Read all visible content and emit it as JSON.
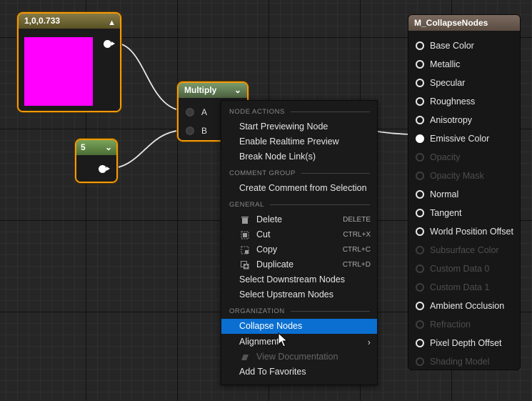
{
  "graph": {
    "color_node": {
      "title": "1,0,0.733",
      "swatch_color": "#ff00ff",
      "collapse_icon": "chevron-up-icon"
    },
    "constant_node": {
      "value": "5"
    },
    "multiply_node": {
      "title": "Multiply",
      "inputs": [
        "A",
        "B"
      ]
    },
    "result_node": {
      "title": "M_CollapseNodes",
      "inputs": [
        {
          "label": "Base Color",
          "enabled": true
        },
        {
          "label": "Metallic",
          "enabled": true
        },
        {
          "label": "Specular",
          "enabled": true
        },
        {
          "label": "Roughness",
          "enabled": true
        },
        {
          "label": "Anisotropy",
          "enabled": true
        },
        {
          "label": "Emissive Color",
          "enabled": true,
          "connected": true
        },
        {
          "label": "Opacity",
          "enabled": false
        },
        {
          "label": "Opacity Mask",
          "enabled": false
        },
        {
          "label": "Normal",
          "enabled": true
        },
        {
          "label": "Tangent",
          "enabled": true
        },
        {
          "label": "World Position Offset",
          "enabled": true
        },
        {
          "label": "Subsurface Color",
          "enabled": false
        },
        {
          "label": "Custom Data 0",
          "enabled": false
        },
        {
          "label": "Custom Data 1",
          "enabled": false
        },
        {
          "label": "Ambient Occlusion",
          "enabled": true
        },
        {
          "label": "Refraction",
          "enabled": false
        },
        {
          "label": "Pixel Depth Offset",
          "enabled": true
        },
        {
          "label": "Shading Model",
          "enabled": false
        }
      ]
    }
  },
  "context_menu": {
    "sections": {
      "node_actions": "NODE ACTIONS",
      "comment_group": "COMMENT GROUP",
      "general": "GENERAL",
      "organization": "ORGANIZATION"
    },
    "items": {
      "start_previewing": "Start Previewing Node",
      "enable_realtime": "Enable Realtime Preview",
      "break_links": "Break Node Link(s)",
      "create_comment": "Create Comment from Selection",
      "delete": {
        "label": "Delete",
        "shortcut": "DELETE",
        "icon": "trash-icon"
      },
      "cut": {
        "label": "Cut",
        "shortcut": "CTRL+X",
        "icon": "scissors-icon"
      },
      "copy": {
        "label": "Copy",
        "shortcut": "CTRL+C",
        "icon": "copy-icon"
      },
      "duplicate": {
        "label": "Duplicate",
        "shortcut": "CTRL+D",
        "icon": "duplicate-icon"
      },
      "select_downstream": "Select Downstream Nodes",
      "select_upstream": "Select Upstream Nodes",
      "collapse_nodes": "Collapse Nodes",
      "alignment": "Alignment",
      "view_docs": {
        "label": "View Documentation",
        "icon": "book-icon"
      },
      "add_favorites": "Add To Favorites"
    },
    "highlight_color": "#0a6fd1"
  }
}
